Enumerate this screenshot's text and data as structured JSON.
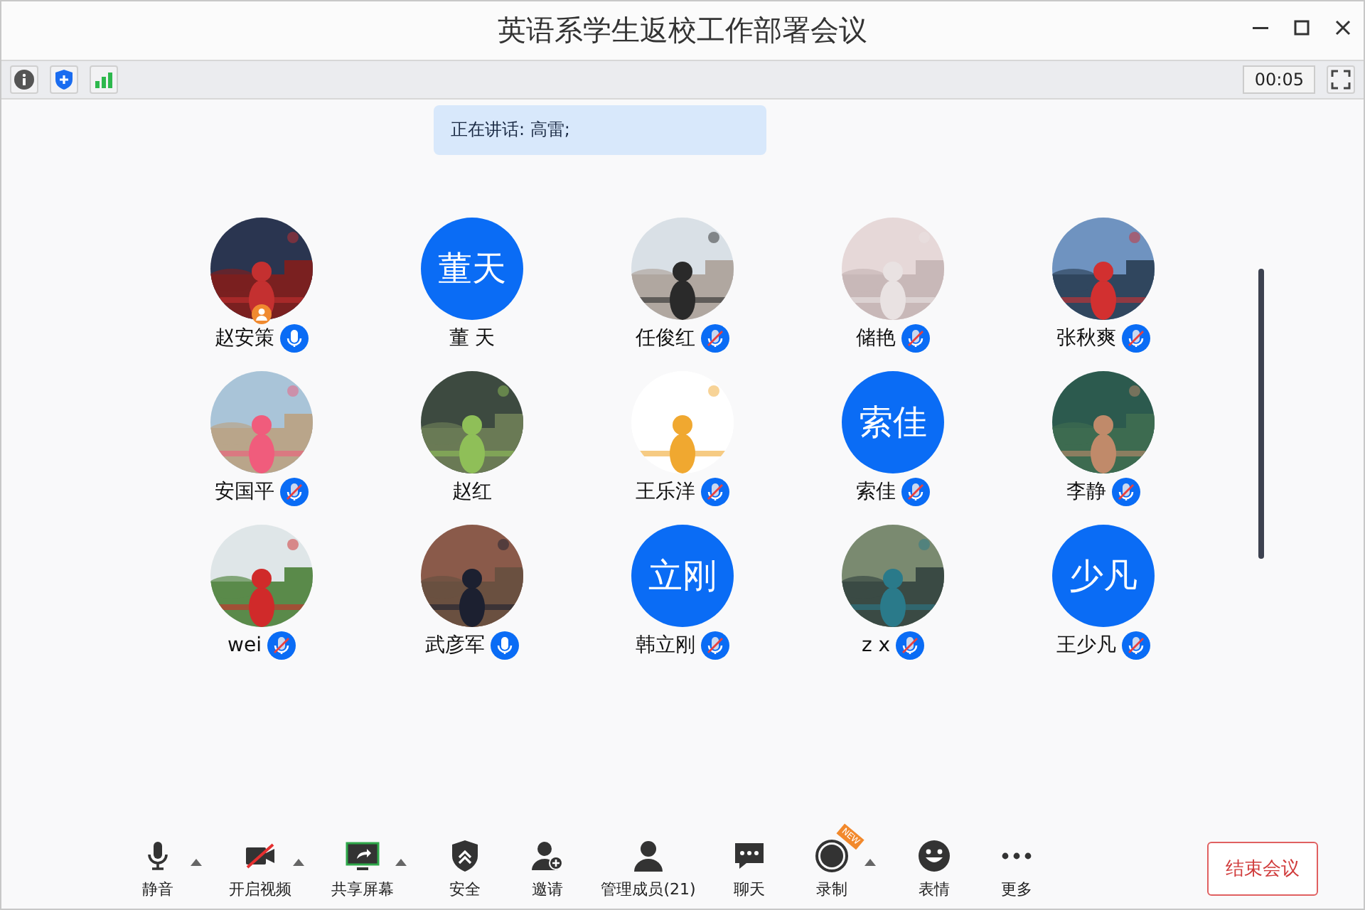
{
  "window": {
    "title": "英语系学生返校工作部署会议"
  },
  "toolbar": {
    "timer": "00:05"
  },
  "speaking": {
    "text": "正在讲话: 高雷;"
  },
  "participants": [
    {
      "name": "赵安策",
      "mic": true,
      "muted": false,
      "host": true
    },
    {
      "name": "董 天",
      "avatar": {
        "kind": "initials",
        "text": "董天"
      },
      "mic": false,
      "host": false
    },
    {
      "name": "任俊红",
      "mic": true,
      "muted": true,
      "host": false
    },
    {
      "name": "储艳",
      "mic": true,
      "muted": true,
      "host": false
    },
    {
      "name": "张秋爽",
      "mic": true,
      "muted": true,
      "host": false
    },
    {
      "name": "安国平",
      "mic": true,
      "muted": true,
      "host": false
    },
    {
      "name": "赵红",
      "mic": false,
      "host": false
    },
    {
      "name": "王乐洋",
      "mic": true,
      "muted": true,
      "host": false
    },
    {
      "name": "索佳",
      "avatar": {
        "kind": "initials",
        "text": "索佳"
      },
      "mic": true,
      "muted": true,
      "host": false
    },
    {
      "name": "李静",
      "mic": true,
      "muted": true,
      "host": false
    },
    {
      "name": "wei",
      "mic": true,
      "muted": true,
      "host": false
    },
    {
      "name": "武彦军",
      "mic": true,
      "muted": false,
      "host": false
    },
    {
      "name": "韩立刚",
      "avatar": {
        "kind": "initials",
        "text": "立刚"
      },
      "mic": true,
      "muted": true,
      "host": false
    },
    {
      "name": "z x",
      "mic": true,
      "muted": true,
      "host": false
    },
    {
      "name": "王少凡",
      "avatar": {
        "kind": "initials",
        "text": "少凡"
      },
      "mic": true,
      "muted": true,
      "host": false
    }
  ],
  "controls": [
    {
      "kind": "mute",
      "label": "静音",
      "caret": true
    },
    {
      "kind": "video",
      "label": "开启视频",
      "caret": true
    },
    {
      "kind": "share",
      "label": "共享屏幕",
      "caret": true
    },
    {
      "kind": "security",
      "label": "安全",
      "caret": false
    },
    {
      "kind": "invite",
      "label": "邀请",
      "caret": false
    },
    {
      "kind": "members",
      "label": "管理成员(21)",
      "caret": false
    },
    {
      "kind": "chat",
      "label": "聊天",
      "caret": false
    },
    {
      "kind": "record",
      "label": "录制",
      "caret": true,
      "badge": "NEW"
    },
    {
      "kind": "reactions",
      "label": "表情",
      "caret": false
    },
    {
      "kind": "more",
      "label": "更多",
      "caret": false
    }
  ],
  "end_button": {
    "label": "结束会议"
  }
}
